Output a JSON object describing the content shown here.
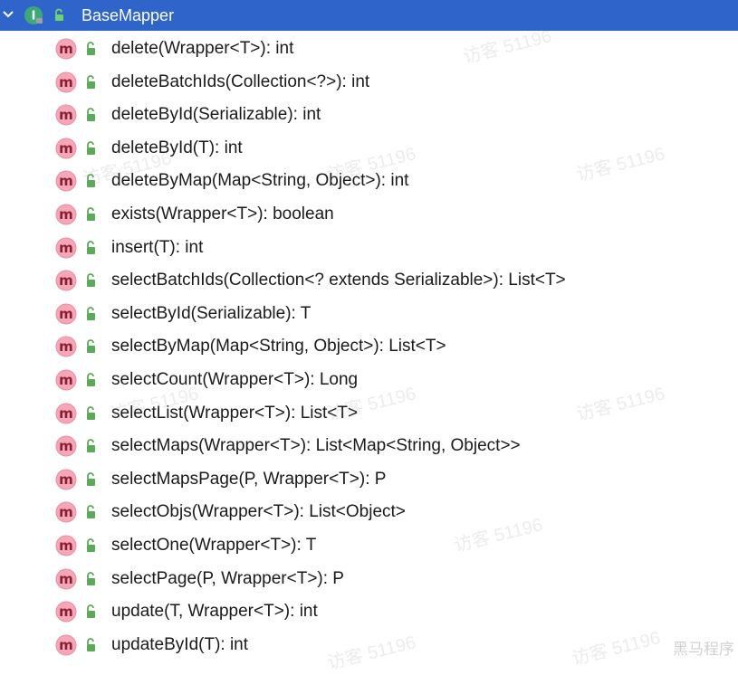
{
  "header": {
    "title": "BaseMapper",
    "interface_letter": "I",
    "colors": {
      "bg": "#2f65ca",
      "text": "#ffffff",
      "interface": "#3ea878"
    }
  },
  "icons": {
    "method": {
      "letter": "m",
      "bg": "#f5a7b7",
      "border": "#e88ea2"
    },
    "lock_color": "#5aaa5a"
  },
  "methods": [
    {
      "sig": "delete(Wrapper<T>): int"
    },
    {
      "sig": "deleteBatchIds(Collection<?>): int"
    },
    {
      "sig": "deleteById(Serializable): int"
    },
    {
      "sig": "deleteById(T): int"
    },
    {
      "sig": "deleteByMap(Map<String, Object>): int"
    },
    {
      "sig": "exists(Wrapper<T>): boolean"
    },
    {
      "sig": "insert(T): int"
    },
    {
      "sig": "selectBatchIds(Collection<? extends Serializable>): List<T>"
    },
    {
      "sig": "selectById(Serializable): T"
    },
    {
      "sig": "selectByMap(Map<String, Object>): List<T>"
    },
    {
      "sig": "selectCount(Wrapper<T>): Long"
    },
    {
      "sig": "selectList(Wrapper<T>): List<T>"
    },
    {
      "sig": "selectMaps(Wrapper<T>): List<Map<String, Object>>"
    },
    {
      "sig": "selectMapsPage(P, Wrapper<T>): P"
    },
    {
      "sig": "selectObjs(Wrapper<T>): List<Object>"
    },
    {
      "sig": "selectOne(Wrapper<T>): T"
    },
    {
      "sig": "selectPage(P, Wrapper<T>): P"
    },
    {
      "sig": "update(T, Wrapper<T>): int"
    },
    {
      "sig": "updateById(T): int"
    }
  ],
  "watermark": {
    "text": "访客 51196",
    "corner": "黑马程序"
  }
}
